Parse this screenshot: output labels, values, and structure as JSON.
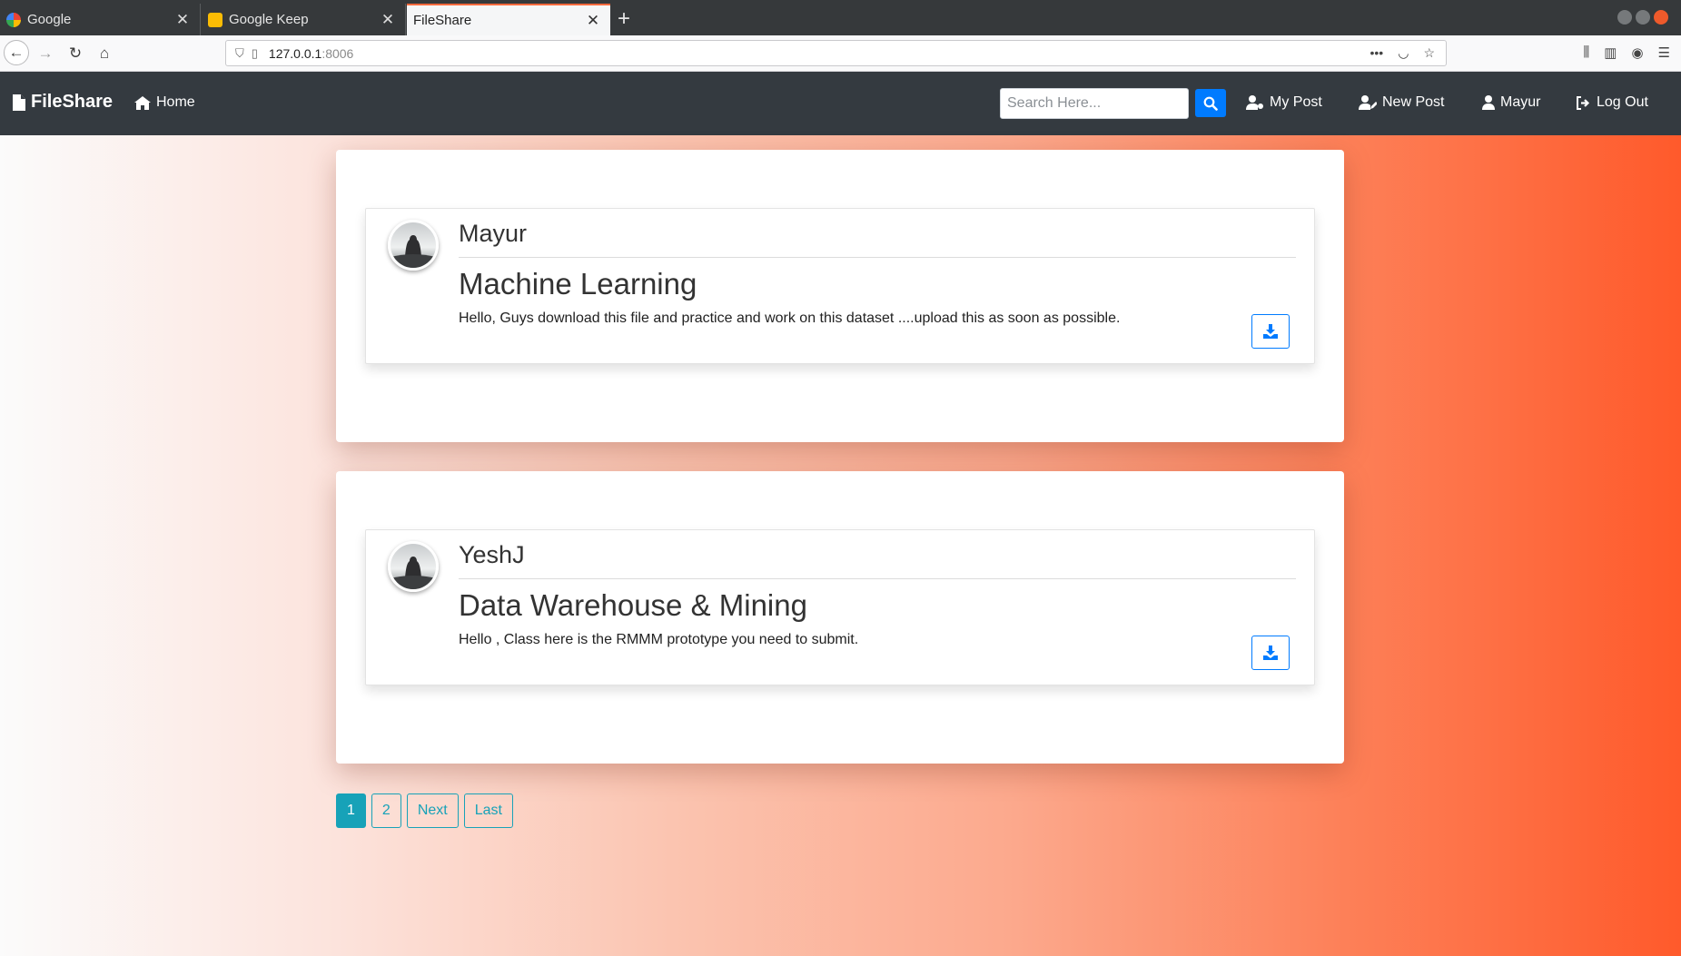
{
  "browser": {
    "tabs": [
      {
        "label": "Google",
        "active": false
      },
      {
        "label": "Google Keep",
        "active": false
      },
      {
        "label": "FileShare",
        "active": true
      }
    ],
    "url_host": "127.0.0.1",
    "url_port": ":8006"
  },
  "site": {
    "brand": "FileShare",
    "nav": {
      "home": "Home",
      "my_post": "My Post",
      "new_post": "New Post",
      "user": "Mayur",
      "logout": "Log Out"
    },
    "search": {
      "placeholder": "Search Here..."
    }
  },
  "posts": [
    {
      "author": "Mayur",
      "title": "Machine Learning",
      "description": "Hello, Guys download this file and practice and work on this dataset ....upload this as soon as possible."
    },
    {
      "author": "YeshJ",
      "title": "Data Warehouse & Mining",
      "description": "Hello , Class here is the RMMM prototype you need to submit."
    }
  ],
  "pagination": {
    "pages": [
      "1",
      "2"
    ],
    "active": "1",
    "next": "Next",
    "last": "Last"
  },
  "colors": {
    "navbar": "#343a40",
    "primary": "#007bff",
    "info": "#17a2b8",
    "gradient_end": "#ff5a2b"
  }
}
